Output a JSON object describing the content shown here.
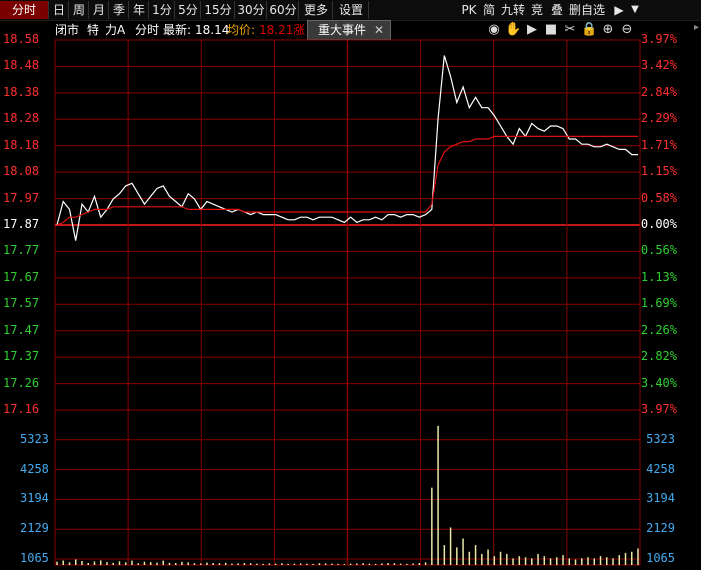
{
  "toolbar": {
    "periods": [
      "分时",
      "日",
      "周",
      "月",
      "季",
      "年",
      "1分",
      "5分",
      "15分",
      "30分",
      "60分",
      "更多",
      "设置"
    ],
    "active_period": "分时",
    "right_buttons": [
      "PK",
      "简",
      "九转",
      "竞",
      "叠",
      "删自选"
    ],
    "nav_right": "▶",
    "menu_down": "▼"
  },
  "info": {
    "status": "闭市",
    "special": "特",
    "name": "力A",
    "view": "分时",
    "latest_label": "最新:",
    "latest": "18.14",
    "avg_label": "均价:",
    "avg": "18.21",
    "change_label": "涨"
  },
  "event_tab": {
    "label": "重大事件",
    "close": "✕"
  },
  "controls": [
    "eye-icon",
    "hand-icon",
    "play-icon",
    "stop-icon",
    "scissors-icon",
    "lock-icon",
    "zoom-in-icon",
    "zoom-out-icon"
  ],
  "price_axis": {
    "left": [
      "18.58",
      "18.48",
      "18.38",
      "18.28",
      "18.18",
      "18.08",
      "17.97",
      "17.87",
      "17.77",
      "17.67",
      "17.57",
      "17.47",
      "17.37",
      "17.26",
      "17.16"
    ],
    "right": [
      "3.97%",
      "3.42%",
      "2.84%",
      "2.29%",
      "1.71%",
      "1.15%",
      "0.58%",
      "0.00%",
      "0.56%",
      "1.13%",
      "1.69%",
      "2.26%",
      "2.82%",
      "3.40%",
      "3.97%"
    ],
    "prev_close": "17.87"
  },
  "volume_axis": {
    "labels": [
      "5323",
      "4258",
      "3194",
      "2129",
      "1065"
    ]
  },
  "colors": {
    "up": "#ff3030",
    "down": "#30d030",
    "neutral": "#ffffff",
    "grid": "#8b0000",
    "volume_axis": "#44aaee",
    "price_line": "#ffffff",
    "avg_line": "#e01010",
    "volume_bar": "#e8e8a8"
  },
  "chart_data": {
    "type": "line",
    "price_range": [
      17.16,
      18.58
    ],
    "prev_close": 17.87,
    "series": [
      {
        "values": [
          17.87,
          17.96,
          17.93,
          17.81,
          17.95,
          17.92,
          17.98,
          17.9,
          17.93,
          17.97,
          17.99,
          18.02,
          18.03,
          17.99,
          17.95,
          17.98,
          18.01,
          18.02,
          17.98,
          17.96,
          17.94,
          17.99,
          17.97,
          17.93,
          17.96,
          17.95,
          17.94,
          17.93,
          17.92,
          17.93,
          17.92,
          17.91,
          17.92,
          17.91,
          17.91,
          17.91,
          17.9,
          17.89,
          17.89,
          17.9,
          17.9,
          17.89,
          17.9,
          17.9,
          17.9,
          17.89,
          17.88,
          17.9,
          17.88,
          17.89,
          17.89,
          17.9,
          17.89,
          17.91,
          17.91,
          17.9,
          17.91,
          17.91,
          17.9,
          17.91,
          17.93,
          18.28,
          18.52,
          18.44,
          18.34,
          18.4,
          18.32,
          18.36,
          18.32,
          18.32,
          18.29,
          18.25,
          18.21,
          18.18,
          18.24,
          18.21,
          18.26,
          18.24,
          18.23,
          18.25,
          18.25,
          18.24,
          18.2,
          18.2,
          18.18,
          18.18,
          18.17,
          18.17,
          18.18,
          18.17,
          18.16,
          18.16,
          18.14,
          18.14
        ]
      },
      {
        "values": [
          17.87,
          17.88,
          17.9,
          17.9,
          17.91,
          17.92,
          17.93,
          17.93,
          17.93,
          17.94,
          17.94,
          17.94,
          17.94,
          17.94,
          17.94,
          17.94,
          17.94,
          17.94,
          17.94,
          17.94,
          17.94,
          17.93,
          17.93,
          17.93,
          17.93,
          17.93,
          17.93,
          17.93,
          17.93,
          17.93,
          17.92,
          17.92,
          17.92,
          17.92,
          17.92,
          17.92,
          17.92,
          17.92,
          17.92,
          17.92,
          17.92,
          17.92,
          17.92,
          17.92,
          17.92,
          17.92,
          17.92,
          17.92,
          17.92,
          17.92,
          17.92,
          17.92,
          17.92,
          17.92,
          17.92,
          17.92,
          17.92,
          17.92,
          17.92,
          17.92,
          17.95,
          18.1,
          18.15,
          18.17,
          18.18,
          18.19,
          18.19,
          18.2,
          18.2,
          18.2,
          18.21,
          18.21,
          18.21,
          18.21,
          18.21,
          18.21,
          18.21,
          18.21,
          18.21,
          18.21,
          18.21,
          18.21,
          18.21,
          18.21,
          18.21,
          18.21,
          18.21,
          18.21,
          18.21,
          18.21,
          18.21,
          18.21,
          18.21,
          18.21
        ]
      }
    ],
    "volume_range": [
      0,
      5323
    ],
    "volume": [
      150,
      200,
      120,
      250,
      180,
      90,
      160,
      210,
      130,
      100,
      170,
      120,
      200,
      80,
      150,
      130,
      110,
      200,
      100,
      90,
      140,
      120,
      80,
      70,
      110,
      90,
      80,
      100,
      60,
      70,
      90,
      80,
      60,
      50,
      70,
      60,
      80,
      50,
      60,
      70,
      60,
      50,
      80,
      70,
      60,
      50,
      40,
      60,
      70,
      80,
      60,
      50,
      70,
      90,
      80,
      60,
      50,
      70,
      90,
      120,
      3500,
      6300,
      900,
      1700,
      800,
      1200,
      600,
      900,
      500,
      700,
      400,
      600,
      500,
      300,
      400,
      350,
      300,
      500,
      400,
      300,
      350,
      450,
      300,
      250,
      300,
      350,
      300,
      400,
      350,
      300,
      450,
      550,
      600,
      750
    ]
  }
}
